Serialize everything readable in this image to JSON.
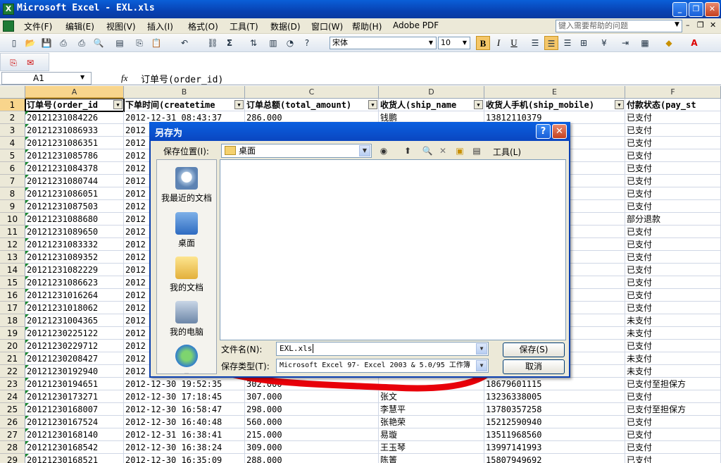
{
  "window": {
    "title": "Microsoft Excel - EXL.xls",
    "min": "_",
    "restore": "❐",
    "close": "✕"
  },
  "menubar": {
    "items": [
      "文件(F)",
      "编辑(E)",
      "视图(V)",
      "插入(I)",
      "格式(O)",
      "工具(T)",
      "数据(D)",
      "窗口(W)",
      "帮助(H)",
      "Adobe PDF"
    ],
    "help_placeholder": "键入需要帮助的问题"
  },
  "toolbar": {
    "font": "宋体",
    "size": "10",
    "bold": "B",
    "italic": "I",
    "underline": "U",
    "sigma": "Σ"
  },
  "formula_bar": {
    "cell_ref": "A1",
    "fx": "fx",
    "value": "订单号(order_id)"
  },
  "sheet": {
    "columns": [
      "A",
      "B",
      "C",
      "D",
      "E",
      "F"
    ],
    "headers": [
      "订单号(order_id",
      "下单时间(createtime",
      "订单总额(total_amount)",
      "收货人(ship_name",
      "收货人手机(ship_mobile)",
      "付款状态(pay_st"
    ],
    "rows": [
      {
        "n": "2",
        "a": "20121231084226",
        "b": "2012-12-31 08:43:37",
        "c": "286.000",
        "d": "钱鹏",
        "e": "13812110379",
        "f": "已支付"
      },
      {
        "n": "3",
        "a": "20121231086933",
        "b": "2012",
        "c": "",
        "d": "",
        "e": "",
        "f": "已支付"
      },
      {
        "n": "4",
        "a": "20121231086351",
        "b": "2012",
        "c": "",
        "d": "",
        "e": "",
        "f": "已支付"
      },
      {
        "n": "5",
        "a": "20121231085786",
        "b": "2012",
        "c": "",
        "d": "",
        "e": "",
        "f": "已支付"
      },
      {
        "n": "6",
        "a": "20121231084378",
        "b": "2012",
        "c": "",
        "d": "",
        "e": "",
        "f": "已支付"
      },
      {
        "n": "7",
        "a": "20121231080744",
        "b": "2012",
        "c": "",
        "d": "",
        "e": "",
        "f": "已支付"
      },
      {
        "n": "8",
        "a": "20121231086051",
        "b": "2012",
        "c": "",
        "d": "",
        "e": "",
        "f": "已支付"
      },
      {
        "n": "9",
        "a": "20121231087503",
        "b": "2012",
        "c": "",
        "d": "",
        "e": "",
        "f": "已支付"
      },
      {
        "n": "10",
        "a": "20121231088680",
        "b": "2012",
        "c": "",
        "d": "",
        "e": "",
        "f": "部分退款"
      },
      {
        "n": "11",
        "a": "20121231089650",
        "b": "2012",
        "c": "",
        "d": "",
        "e": "",
        "f": "已支付"
      },
      {
        "n": "12",
        "a": "20121231083332",
        "b": "2012",
        "c": "",
        "d": "",
        "e": "",
        "f": "已支付"
      },
      {
        "n": "13",
        "a": "20121231089352",
        "b": "2012",
        "c": "",
        "d": "",
        "e": "",
        "f": "已支付"
      },
      {
        "n": "14",
        "a": "20121231082229",
        "b": "2012",
        "c": "",
        "d": "",
        "e": "",
        "f": "已支付"
      },
      {
        "n": "15",
        "a": "20121231086623",
        "b": "2012",
        "c": "",
        "d": "",
        "e": "",
        "f": "已支付"
      },
      {
        "n": "16",
        "a": "20121231016264",
        "b": "2012",
        "c": "",
        "d": "",
        "e": "",
        "f": "已支付"
      },
      {
        "n": "17",
        "a": "20121231018062",
        "b": "2012",
        "c": "",
        "d": "",
        "e": "",
        "f": "已支付"
      },
      {
        "n": "18",
        "a": "20121231004365",
        "b": "2012",
        "c": "",
        "d": "",
        "e": "",
        "f": "未支付"
      },
      {
        "n": "19",
        "a": "20121230225122",
        "b": "2012",
        "c": "",
        "d": "",
        "e": "",
        "f": "未支付"
      },
      {
        "n": "20",
        "a": "20121230229712",
        "b": "2012",
        "c": "",
        "d": "",
        "e": "",
        "f": "已支付"
      },
      {
        "n": "21",
        "a": "20121230208427",
        "b": "2012",
        "c": "",
        "d": "",
        "e": "",
        "f": "未支付"
      },
      {
        "n": "22",
        "a": "20121230192940",
        "b": "2012",
        "c": "",
        "d": "",
        "e": "",
        "f": "未支付"
      },
      {
        "n": "23",
        "a": "20121230194651",
        "b": "2012-12-30 19:52:35",
        "c": "302.000",
        "d": "",
        "e": "18679601115",
        "f": "已支付至担保方"
      },
      {
        "n": "24",
        "a": "20121230173271",
        "b": "2012-12-30 17:18:45",
        "c": "307.000",
        "d": "张文",
        "e": "13236338005",
        "f": "已支付"
      },
      {
        "n": "25",
        "a": "20121230168007",
        "b": "2012-12-30 16:58:47",
        "c": "298.000",
        "d": "李慧平",
        "e": "13780357258",
        "f": "已支付至担保方"
      },
      {
        "n": "26",
        "a": "20121230167524",
        "b": "2012-12-30 16:40:48",
        "c": "560.000",
        "d": "张艳荣",
        "e": "15212590940",
        "f": "已支付"
      },
      {
        "n": "27",
        "a": "20121230168140",
        "b": "2012-12-31 16:38:41",
        "c": "215.000",
        "d": "易璇",
        "e": "13511968560",
        "f": "已支付"
      },
      {
        "n": "28",
        "a": "20121230168542",
        "b": "2012-12-30 16:38:24",
        "c": "309.000",
        "d": "王玉琴",
        "e": "13997141993",
        "f": "已支付"
      },
      {
        "n": "29",
        "a": "20121230168521",
        "b": "2012-12-30 16:35:09",
        "c": "288.000",
        "d": "陈箐",
        "e": "15807949692",
        "f": "已支付"
      }
    ]
  },
  "dialog": {
    "title": "另存为",
    "help": "?",
    "close": "✕",
    "save_in_label": "保存位置(I):",
    "save_in_value": "桌面",
    "tools_label": "工具(L)",
    "places": [
      "我最近的文档",
      "桌面",
      "我的文档",
      "我的电脑"
    ],
    "filename_label": "文件名(N):",
    "filename_value": "EXL.xls",
    "filetype_label": "保存类型(T):",
    "filetype_value": "Microsoft Excel 97- Excel 2003 & 5.0/95 工作簿",
    "save_button": "保存(S)",
    "cancel_button": "取消"
  },
  "colors": {
    "title_bar": "#0a4fc8",
    "annotation": "#e8000a",
    "selected_header": "#f8d58c"
  }
}
